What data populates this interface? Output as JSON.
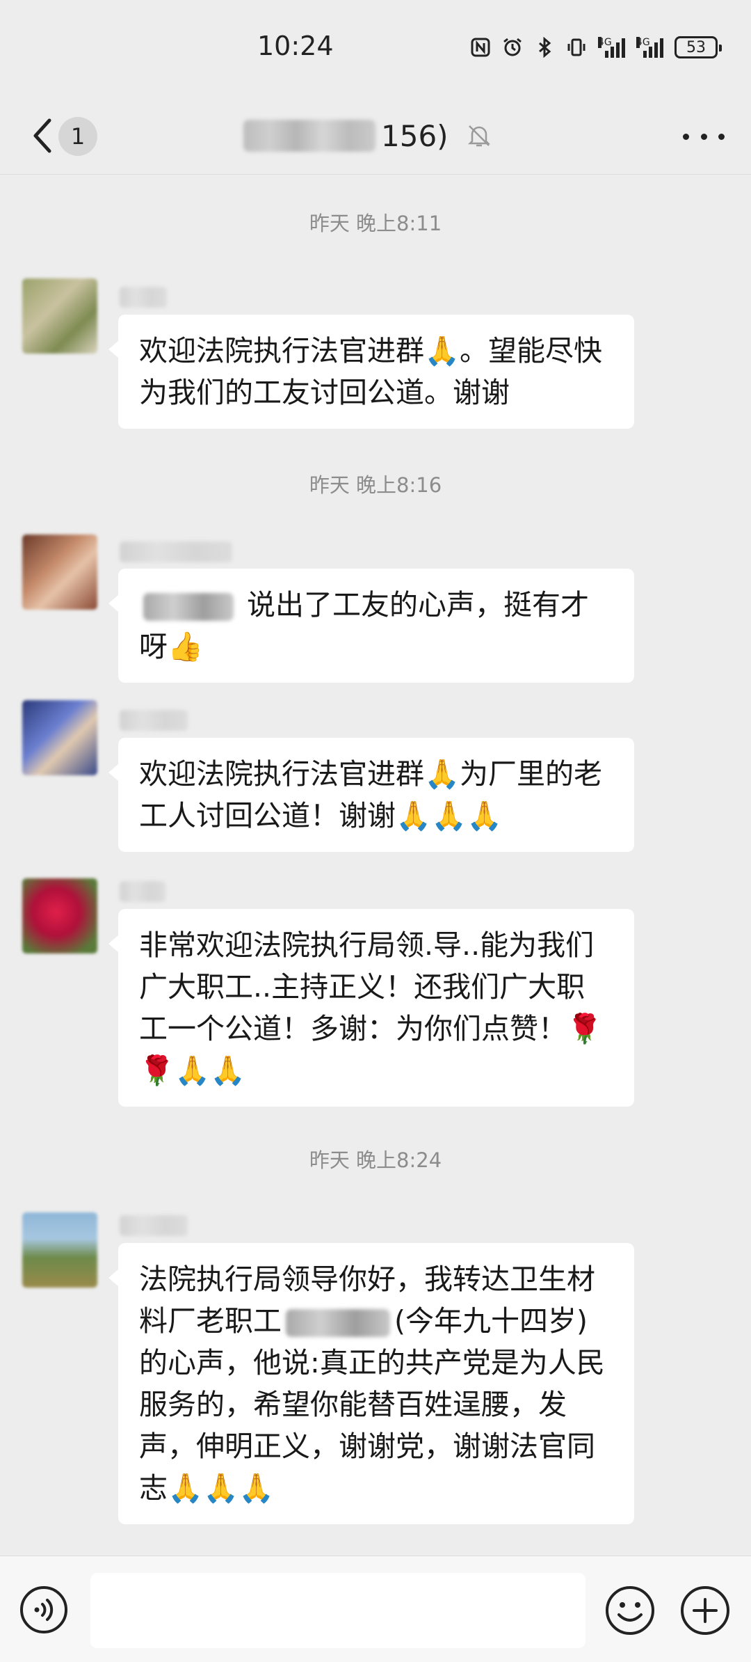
{
  "status_bar": {
    "time": "10:24",
    "signal1_label": "4G",
    "signal2_label": "4G",
    "battery": "53"
  },
  "header": {
    "unread_count": "1",
    "title_suffix": "156)",
    "icons": [
      "back-icon",
      "mute-bell-icon",
      "more-icon"
    ]
  },
  "chat": {
    "timestamps": [
      "昨天 晚上8:11",
      "昨天 晚上8:16",
      "昨天 晚上8:24"
    ],
    "messages": [
      {
        "text": "欢迎法院执行法官进群🙏。望能尽快为我们的工友讨回公道。谢谢"
      },
      {
        "text_after_mention": "说出了工友的心声，挺有才呀👍"
      },
      {
        "text": "欢迎法院执行法官进群🙏为厂里的老工人讨回公道！谢谢🙏🙏🙏"
      },
      {
        "text": "非常欢迎法院执行局领.导..能为我们广大职工..主持正义！还我们广大职工一个公道！多谢：为你们点赞！🌹🌹🙏🙏"
      },
      {
        "text_part1": "法院执行局领导你好，我转达卫生材料厂老职工",
        "text_part2": "(今年九十四岁)的心声，他说:真正的共产党是为人民服务的，希望你能替百姓逞腰，发声，伸明正义，谢谢党，谢谢法官同志🙏🙏🙏"
      }
    ]
  },
  "input_bar": {
    "placeholder": "",
    "icons": [
      "voice-icon",
      "emoji-icon",
      "plus-icon"
    ]
  }
}
